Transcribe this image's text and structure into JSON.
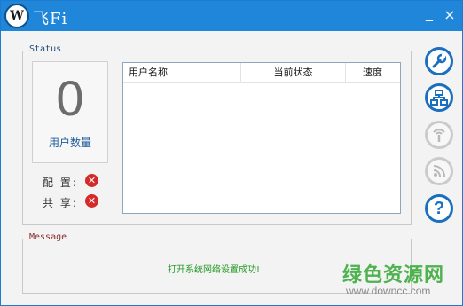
{
  "window": {
    "title": "飞Fi",
    "logo_text": "W",
    "minimize_label": "_",
    "close_label": "×"
  },
  "status": {
    "group_title": "Status",
    "user_count": "0",
    "user_count_label": "用户数量",
    "config_label": "配 置:",
    "share_label": "共 享:",
    "config_state_icon": "error-x-icon",
    "share_state_icon": "error-x-icon"
  },
  "table": {
    "columns": [
      "用户名称",
      "当前状态",
      "速度"
    ],
    "rows": []
  },
  "sidebar": {
    "buttons": [
      {
        "name": "settings-wrench",
        "icon": "wrench-icon",
        "enabled": true
      },
      {
        "name": "network",
        "icon": "network-icon",
        "enabled": true
      },
      {
        "name": "wifi",
        "icon": "wireless-icon",
        "enabled": false
      },
      {
        "name": "wifi-share",
        "icon": "signal-icon",
        "enabled": false
      },
      {
        "name": "help",
        "icon": "help-icon",
        "glyph": "?",
        "enabled": true
      }
    ]
  },
  "message": {
    "group_title": "Message",
    "text": "打开系统网络设置成功!"
  },
  "watermark": {
    "site_name": "绿色资源网",
    "url": "www.downcc.com"
  },
  "colors": {
    "titlebar": "#1f86da",
    "accent": "#1a6fbf",
    "error": "#d42a2a",
    "success_text": "#2a9a2a",
    "watermark_green": "#4eb24e"
  }
}
